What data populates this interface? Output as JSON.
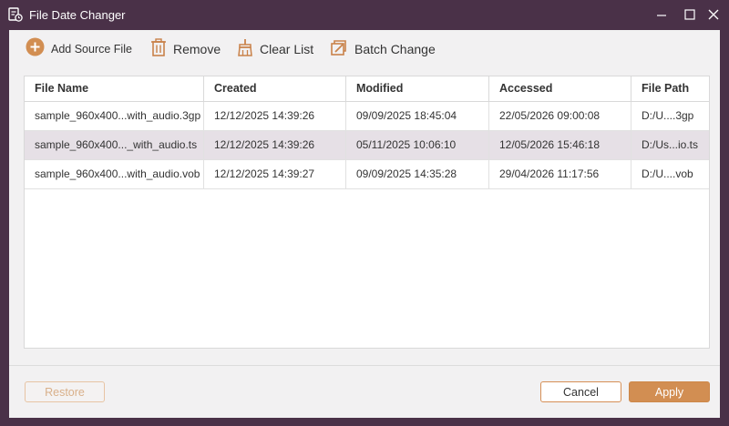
{
  "window": {
    "title": "File Date Changer"
  },
  "toolbar": {
    "add_label": "Add Source File",
    "remove_label": "Remove",
    "clear_label": "Clear List",
    "batch_label": "Batch Change"
  },
  "table": {
    "columns": [
      "File Name",
      "Created",
      "Modified",
      "Accessed",
      "File Path"
    ],
    "rows": [
      {
        "name": "sample_960x400...with_audio.3gp",
        "created": "12/12/2025 14:39:26",
        "modified": "09/09/2025 18:45:04",
        "accessed": "22/05/2026 09:00:08",
        "path": "D:/U....3gp"
      },
      {
        "name": "sample_960x400..._with_audio.ts",
        "created": "12/12/2025 14:39:26",
        "modified": "05/11/2025 10:06:10",
        "accessed": "12/05/2026 15:46:18",
        "path": "D:/Us...io.ts"
      },
      {
        "name": "sample_960x400...with_audio.vob",
        "created": "12/12/2025 14:39:27",
        "modified": "09/09/2025 14:35:28",
        "accessed": "29/04/2026 11:17:56",
        "path": "D:/U....vob"
      }
    ],
    "selected_row": 1
  },
  "footer": {
    "restore_label": "Restore",
    "cancel_label": "Cancel",
    "apply_label": "Apply"
  },
  "colors": {
    "accent": "#d28e52",
    "titlebar": "#4a3148",
    "selected_row": "#e6e0e6"
  },
  "icons": [
    "app-icon",
    "minimize-icon",
    "maximize-icon",
    "close-icon",
    "add-circle-icon",
    "trash-icon",
    "broom-icon",
    "batch-edit-icon"
  ]
}
